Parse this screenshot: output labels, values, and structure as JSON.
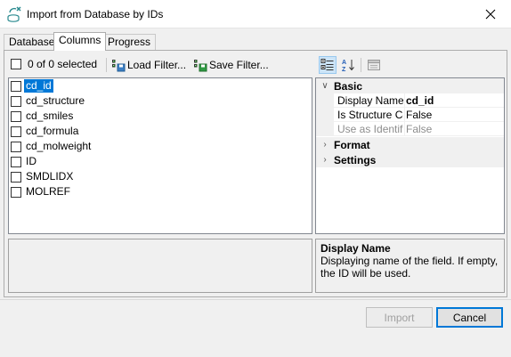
{
  "window": {
    "title": "Import from Database by IDs",
    "app_icon": "database-import-icon",
    "close_icon": "close-icon"
  },
  "tabs": [
    {
      "label": "Database",
      "active": false
    },
    {
      "label": "Columns",
      "active": true
    },
    {
      "label": "Progress",
      "active": false
    }
  ],
  "toolbar": {
    "select_all_label": "0 of 0 selected",
    "load_filter_label": "Load Filter...",
    "save_filter_label": "Save Filter..."
  },
  "columns": [
    {
      "label": "cd_id",
      "checked": false,
      "selected": true
    },
    {
      "label": "cd_structure",
      "checked": false,
      "selected": false
    },
    {
      "label": "cd_smiles",
      "checked": false,
      "selected": false
    },
    {
      "label": "cd_formula",
      "checked": false,
      "selected": false
    },
    {
      "label": "cd_molweight",
      "checked": false,
      "selected": false
    },
    {
      "label": "ID",
      "checked": false,
      "selected": false
    },
    {
      "label": "SMDLIDX",
      "checked": false,
      "selected": false
    },
    {
      "label": "MOLREF",
      "checked": false,
      "selected": false
    }
  ],
  "property_grid": {
    "toolbar_icons": [
      "categorized-icon",
      "alphabetical-sort-icon",
      "property-pages-icon"
    ],
    "categories": {
      "basic": "Basic",
      "format": "Format",
      "settings": "Settings"
    },
    "basic_rows": [
      {
        "name": "Display Name",
        "value": "cd_id",
        "bold": true,
        "disabled": false
      },
      {
        "name": "Is Structure Cc",
        "value": "False",
        "bold": false,
        "disabled": false
      },
      {
        "name": "Use as Identifi",
        "value": "False",
        "bold": false,
        "disabled": true
      }
    ]
  },
  "help": {
    "title": "Display Name",
    "description": "Displaying name of the field. If empty, the ID will be used."
  },
  "buttons": {
    "import_label": "Import",
    "cancel_label": "Cancel"
  },
  "colors": {
    "selection": "#0078d7",
    "window_bg": "#f0f0f0"
  }
}
